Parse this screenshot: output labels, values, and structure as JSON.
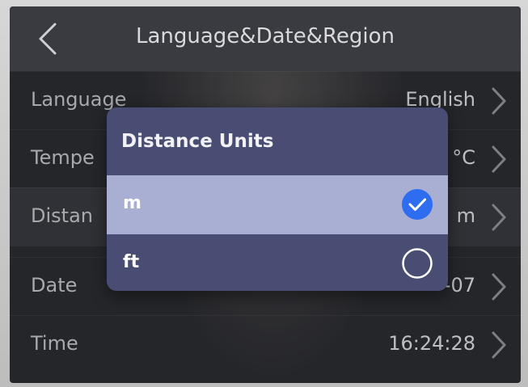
{
  "header": {
    "title": "Language&Date&Region",
    "back_icon": "chevron-left-icon"
  },
  "settings": [
    {
      "label": "Language",
      "value": "English"
    },
    {
      "label": "Tempe",
      "value": "°C"
    },
    {
      "label": "Distan",
      "value": "m"
    },
    {
      "label": "Date",
      "value": "-07"
    },
    {
      "label": "Time",
      "value": "16:24:28"
    }
  ],
  "dialog": {
    "title": "Distance Units",
    "options": [
      {
        "label": "m",
        "selected": true
      },
      {
        "label": "ft",
        "selected": false
      }
    ]
  },
  "colors": {
    "screen_bg": "#2e2f34",
    "dialog_bg": "#4a4d73",
    "selected_row": "#a9aed3",
    "check_blue": "#2f6df0"
  }
}
